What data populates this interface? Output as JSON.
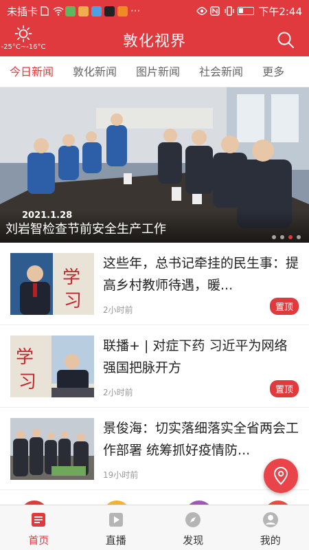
{
  "status_bar": {
    "carrier": "未插卡",
    "time": "下午2:44",
    "ellipsis": "···"
  },
  "header": {
    "title": "敦化视界",
    "weather_temp": "-25°C~-16°C"
  },
  "tabs": [
    {
      "label": "今日新闻",
      "active": true
    },
    {
      "label": "敦化新闻",
      "active": false
    },
    {
      "label": "图片新闻",
      "active": false
    },
    {
      "label": "社会新闻",
      "active": false
    },
    {
      "label": "更多",
      "active": false
    }
  ],
  "banner": {
    "date": "2021.1.28",
    "caption": "刘岩智检查节前安全生产工作",
    "slide_count": 4,
    "active_slide": 3
  },
  "news": [
    {
      "title": "这些年，总书记牵挂的民生事：提高乡村教师待遇，暖...",
      "time": "2小时前",
      "badge": "置顶"
    },
    {
      "title": "联播+ | 对症下药 习近平为网络强国把脉开方",
      "time": "2小时前",
      "badge": "置顶"
    },
    {
      "title": "景俊海：切实落细落实全省两会工作部署 统筹抓好疫情防...",
      "time": "19小时前",
      "badge": ""
    }
  ],
  "thumb_text": {
    "study": "学习"
  },
  "bottom_nav": [
    {
      "label": "首页",
      "active": true
    },
    {
      "label": "直播",
      "active": false
    },
    {
      "label": "发现",
      "active": false
    },
    {
      "label": "我的",
      "active": false
    }
  ],
  "colors": {
    "accent": "#e0393e",
    "text": "#222222",
    "muted": "#999999"
  },
  "icons": {
    "weather": "sun-icon",
    "search": "search-icon",
    "fab": "location-pin-icon",
    "nav": [
      "news-icon",
      "video-icon",
      "compass-icon",
      "user-icon"
    ]
  }
}
